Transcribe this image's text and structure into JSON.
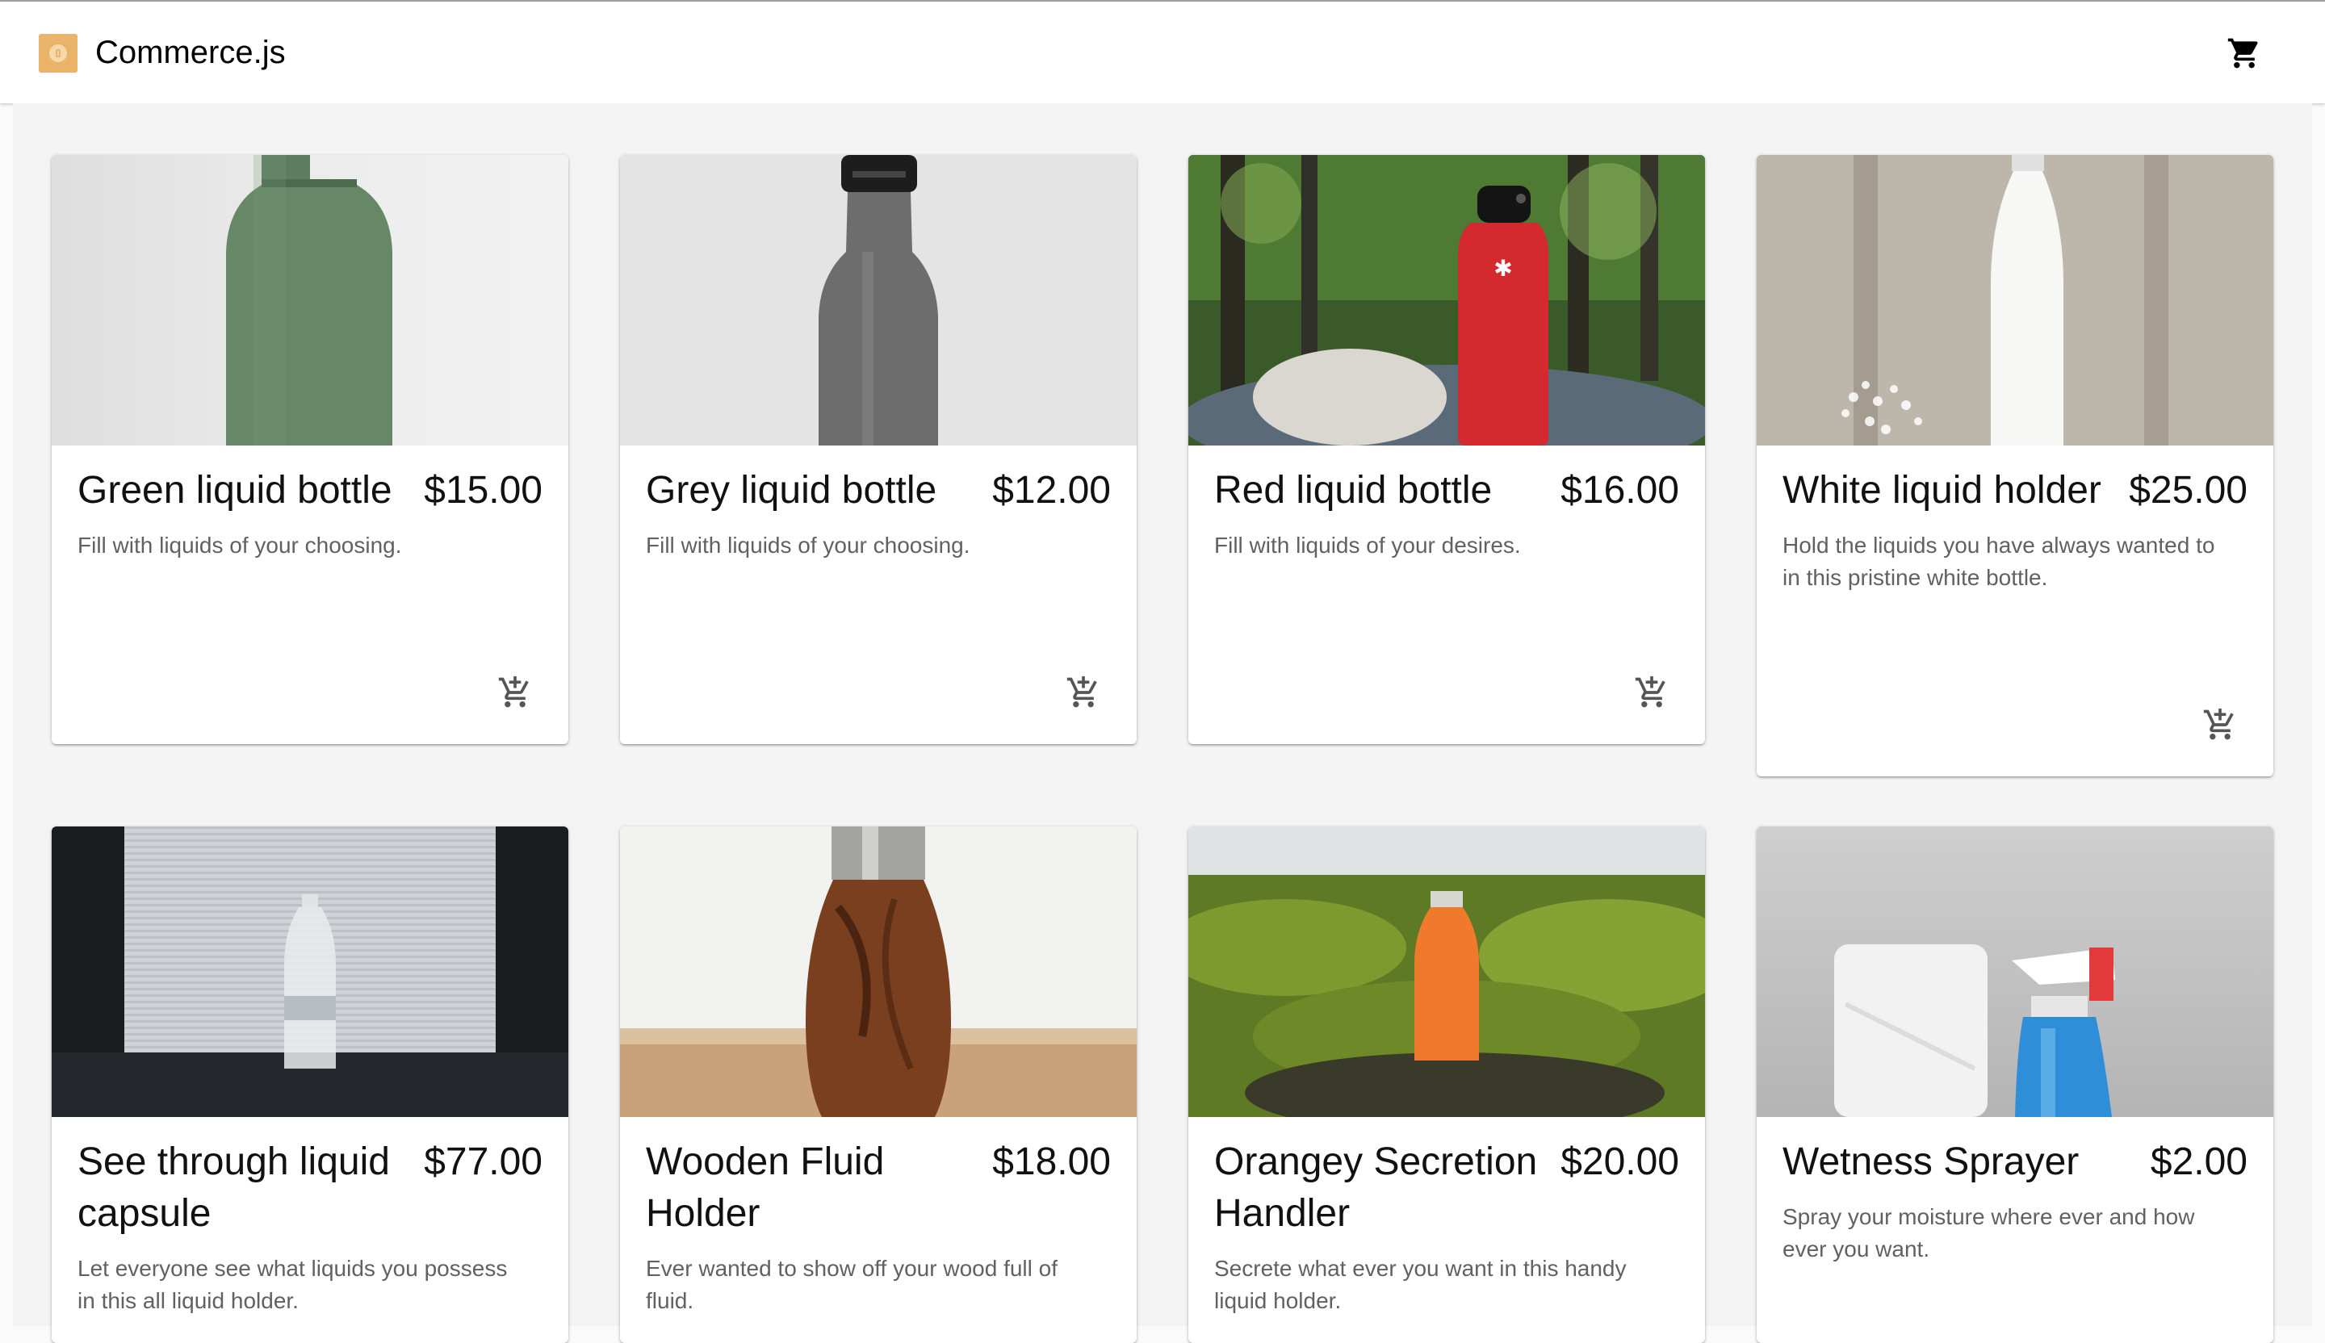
{
  "app": {
    "title": "Commerce.js"
  },
  "header": {
    "cart_icon": "shopping-cart-icon"
  },
  "products": [
    {
      "name": "Green liquid bottle",
      "price": "$15.00",
      "description": "Fill with liquids of your choosing."
    },
    {
      "name": "Grey liquid bottle",
      "price": "$12.00",
      "description": "Fill with liquids of your choosing."
    },
    {
      "name": "Red liquid bottle",
      "price": "$16.00",
      "description": "Fill with liquids of your desires."
    },
    {
      "name": "White liquid holder",
      "price": "$25.00",
      "description": "Hold the liquids you have always wanted to in this pristine white bottle."
    },
    {
      "name": "See through liquid capsule",
      "price": "$77.00",
      "description": "Let everyone see what liquids you possess in this all liquid holder."
    },
    {
      "name": "Wooden Fluid Holder",
      "price": "$18.00",
      "description": "Ever wanted to show off your wood full of fluid."
    },
    {
      "name": "Orangey Secretion Handler",
      "price": "$20.00",
      "description": "Secrete what ever you want in this handy liquid holder."
    },
    {
      "name": "Wetness Sprayer",
      "price": "$2.00",
      "description": "Spray your moisture where ever and how ever you want."
    }
  ],
  "icons": {
    "add_to_cart": "add-shopping-cart-icon"
  },
  "colors": {
    "logo": "#e9b36a",
    "background": "#f4f4f4",
    "card": "#ffffff"
  }
}
